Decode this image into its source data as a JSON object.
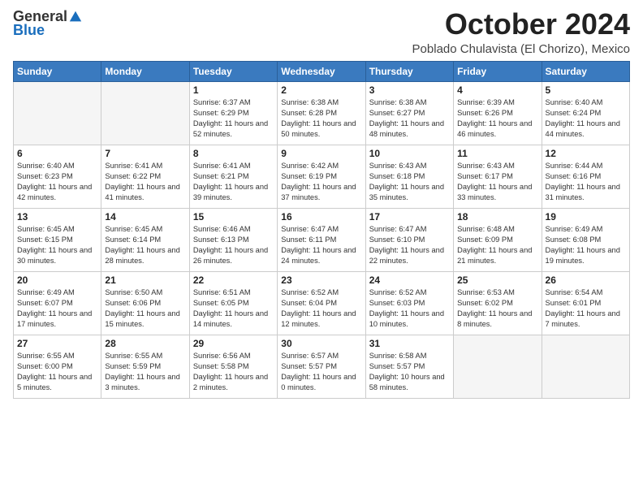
{
  "header": {
    "logo_general": "General",
    "logo_blue": "Blue",
    "month": "October 2024",
    "location": "Poblado Chulavista (El Chorizo), Mexico"
  },
  "weekdays": [
    "Sunday",
    "Monday",
    "Tuesday",
    "Wednesday",
    "Thursday",
    "Friday",
    "Saturday"
  ],
  "weeks": [
    [
      {
        "day": "",
        "sunrise": "",
        "sunset": "",
        "daylight": "",
        "empty": true
      },
      {
        "day": "",
        "sunrise": "",
        "sunset": "",
        "daylight": "",
        "empty": true
      },
      {
        "day": "1",
        "sunrise": "Sunrise: 6:37 AM",
        "sunset": "Sunset: 6:29 PM",
        "daylight": "Daylight: 11 hours and 52 minutes.",
        "empty": false
      },
      {
        "day": "2",
        "sunrise": "Sunrise: 6:38 AM",
        "sunset": "Sunset: 6:28 PM",
        "daylight": "Daylight: 11 hours and 50 minutes.",
        "empty": false
      },
      {
        "day": "3",
        "sunrise": "Sunrise: 6:38 AM",
        "sunset": "Sunset: 6:27 PM",
        "daylight": "Daylight: 11 hours and 48 minutes.",
        "empty": false
      },
      {
        "day": "4",
        "sunrise": "Sunrise: 6:39 AM",
        "sunset": "Sunset: 6:26 PM",
        "daylight": "Daylight: 11 hours and 46 minutes.",
        "empty": false
      },
      {
        "day": "5",
        "sunrise": "Sunrise: 6:40 AM",
        "sunset": "Sunset: 6:24 PM",
        "daylight": "Daylight: 11 hours and 44 minutes.",
        "empty": false
      }
    ],
    [
      {
        "day": "6",
        "sunrise": "Sunrise: 6:40 AM",
        "sunset": "Sunset: 6:23 PM",
        "daylight": "Daylight: 11 hours and 42 minutes.",
        "empty": false
      },
      {
        "day": "7",
        "sunrise": "Sunrise: 6:41 AM",
        "sunset": "Sunset: 6:22 PM",
        "daylight": "Daylight: 11 hours and 41 minutes.",
        "empty": false
      },
      {
        "day": "8",
        "sunrise": "Sunrise: 6:41 AM",
        "sunset": "Sunset: 6:21 PM",
        "daylight": "Daylight: 11 hours and 39 minutes.",
        "empty": false
      },
      {
        "day": "9",
        "sunrise": "Sunrise: 6:42 AM",
        "sunset": "Sunset: 6:19 PM",
        "daylight": "Daylight: 11 hours and 37 minutes.",
        "empty": false
      },
      {
        "day": "10",
        "sunrise": "Sunrise: 6:43 AM",
        "sunset": "Sunset: 6:18 PM",
        "daylight": "Daylight: 11 hours and 35 minutes.",
        "empty": false
      },
      {
        "day": "11",
        "sunrise": "Sunrise: 6:43 AM",
        "sunset": "Sunset: 6:17 PM",
        "daylight": "Daylight: 11 hours and 33 minutes.",
        "empty": false
      },
      {
        "day": "12",
        "sunrise": "Sunrise: 6:44 AM",
        "sunset": "Sunset: 6:16 PM",
        "daylight": "Daylight: 11 hours and 31 minutes.",
        "empty": false
      }
    ],
    [
      {
        "day": "13",
        "sunrise": "Sunrise: 6:45 AM",
        "sunset": "Sunset: 6:15 PM",
        "daylight": "Daylight: 11 hours and 30 minutes.",
        "empty": false
      },
      {
        "day": "14",
        "sunrise": "Sunrise: 6:45 AM",
        "sunset": "Sunset: 6:14 PM",
        "daylight": "Daylight: 11 hours and 28 minutes.",
        "empty": false
      },
      {
        "day": "15",
        "sunrise": "Sunrise: 6:46 AM",
        "sunset": "Sunset: 6:13 PM",
        "daylight": "Daylight: 11 hours and 26 minutes.",
        "empty": false
      },
      {
        "day": "16",
        "sunrise": "Sunrise: 6:47 AM",
        "sunset": "Sunset: 6:11 PM",
        "daylight": "Daylight: 11 hours and 24 minutes.",
        "empty": false
      },
      {
        "day": "17",
        "sunrise": "Sunrise: 6:47 AM",
        "sunset": "Sunset: 6:10 PM",
        "daylight": "Daylight: 11 hours and 22 minutes.",
        "empty": false
      },
      {
        "day": "18",
        "sunrise": "Sunrise: 6:48 AM",
        "sunset": "Sunset: 6:09 PM",
        "daylight": "Daylight: 11 hours and 21 minutes.",
        "empty": false
      },
      {
        "day": "19",
        "sunrise": "Sunrise: 6:49 AM",
        "sunset": "Sunset: 6:08 PM",
        "daylight": "Daylight: 11 hours and 19 minutes.",
        "empty": false
      }
    ],
    [
      {
        "day": "20",
        "sunrise": "Sunrise: 6:49 AM",
        "sunset": "Sunset: 6:07 PM",
        "daylight": "Daylight: 11 hours and 17 minutes.",
        "empty": false
      },
      {
        "day": "21",
        "sunrise": "Sunrise: 6:50 AM",
        "sunset": "Sunset: 6:06 PM",
        "daylight": "Daylight: 11 hours and 15 minutes.",
        "empty": false
      },
      {
        "day": "22",
        "sunrise": "Sunrise: 6:51 AM",
        "sunset": "Sunset: 6:05 PM",
        "daylight": "Daylight: 11 hours and 14 minutes.",
        "empty": false
      },
      {
        "day": "23",
        "sunrise": "Sunrise: 6:52 AM",
        "sunset": "Sunset: 6:04 PM",
        "daylight": "Daylight: 11 hours and 12 minutes.",
        "empty": false
      },
      {
        "day": "24",
        "sunrise": "Sunrise: 6:52 AM",
        "sunset": "Sunset: 6:03 PM",
        "daylight": "Daylight: 11 hours and 10 minutes.",
        "empty": false
      },
      {
        "day": "25",
        "sunrise": "Sunrise: 6:53 AM",
        "sunset": "Sunset: 6:02 PM",
        "daylight": "Daylight: 11 hours and 8 minutes.",
        "empty": false
      },
      {
        "day": "26",
        "sunrise": "Sunrise: 6:54 AM",
        "sunset": "Sunset: 6:01 PM",
        "daylight": "Daylight: 11 hours and 7 minutes.",
        "empty": false
      }
    ],
    [
      {
        "day": "27",
        "sunrise": "Sunrise: 6:55 AM",
        "sunset": "Sunset: 6:00 PM",
        "daylight": "Daylight: 11 hours and 5 minutes.",
        "empty": false
      },
      {
        "day": "28",
        "sunrise": "Sunrise: 6:55 AM",
        "sunset": "Sunset: 5:59 PM",
        "daylight": "Daylight: 11 hours and 3 minutes.",
        "empty": false
      },
      {
        "day": "29",
        "sunrise": "Sunrise: 6:56 AM",
        "sunset": "Sunset: 5:58 PM",
        "daylight": "Daylight: 11 hours and 2 minutes.",
        "empty": false
      },
      {
        "day": "30",
        "sunrise": "Sunrise: 6:57 AM",
        "sunset": "Sunset: 5:57 PM",
        "daylight": "Daylight: 11 hours and 0 minutes.",
        "empty": false
      },
      {
        "day": "31",
        "sunrise": "Sunrise: 6:58 AM",
        "sunset": "Sunset: 5:57 PM",
        "daylight": "Daylight: 10 hours and 58 minutes.",
        "empty": false
      },
      {
        "day": "",
        "sunrise": "",
        "sunset": "",
        "daylight": "",
        "empty": true
      },
      {
        "day": "",
        "sunrise": "",
        "sunset": "",
        "daylight": "",
        "empty": true
      }
    ]
  ]
}
